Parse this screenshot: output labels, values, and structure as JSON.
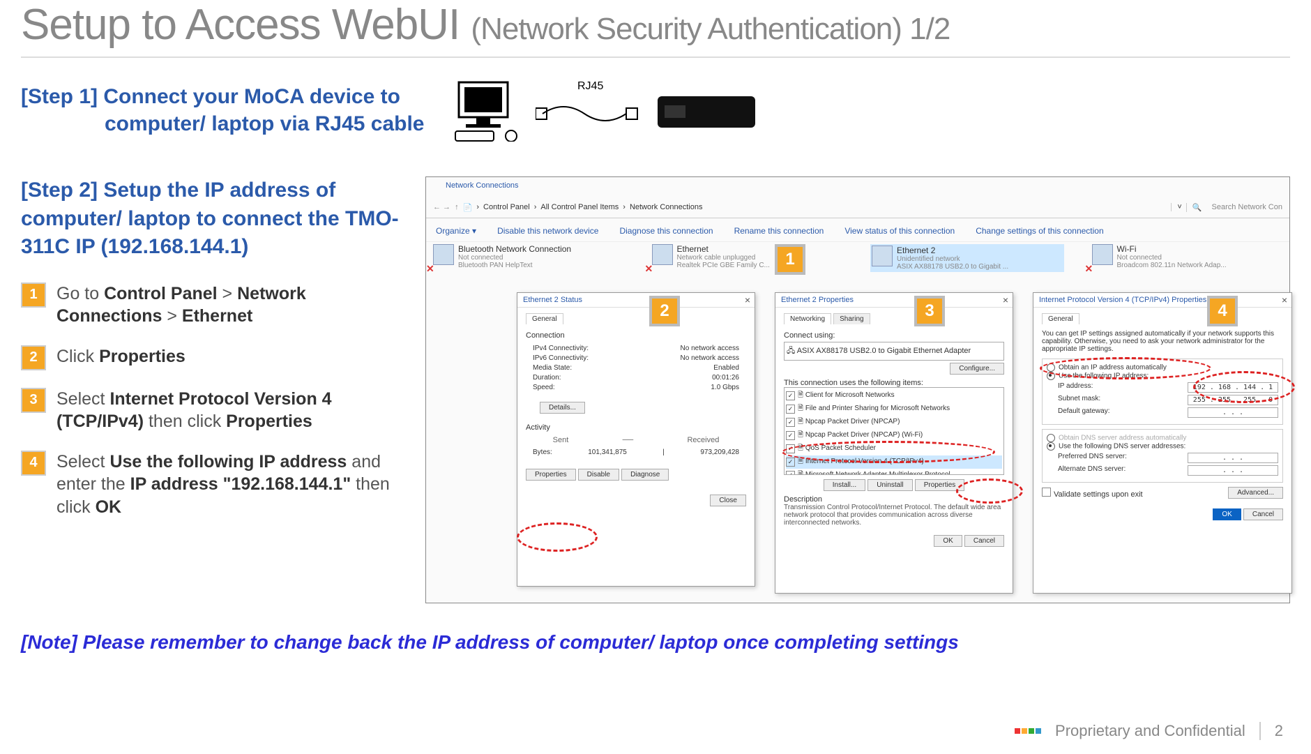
{
  "title_main": "Setup to Access WebUI ",
  "title_sub": "(Network Security Authentication) 1/2",
  "step1_line1": "[Step 1] Connect your MoCA device to",
  "step1_line2": "computer/ laptop via RJ45 cable",
  "rj45_label": "RJ45",
  "step2_head": "[Step 2] Setup the IP address of computer/ laptop to connect the TMO-311C IP (192.168.144.1)",
  "items": [
    {
      "n": "1",
      "html": "Go to <b>Control Panel</b> > <b>Network Connections</b>  > <b>Ethernet</b>"
    },
    {
      "n": "2",
      "html": "Click <b>Properties</b>"
    },
    {
      "n": "3",
      "html": "Select <b>Internet Protocol Version 4 (TCP/IPv4)</b> then click <b>Properties</b>"
    },
    {
      "n": "4",
      "html": "Select <b>Use the following IP address</b> and enter the <b>IP address \"192.168.144.1\"</b> then click <b>OK</b>"
    }
  ],
  "explorer": {
    "win_label": "Network Connections",
    "breadcrumb": [
      "Control Panel",
      "All Control Panel Items",
      "Network Connections"
    ],
    "search_placeholder": "Search Network Con",
    "toolbar": [
      "Organize ▾",
      "Disable this network device",
      "Diagnose this connection",
      "Rename this connection",
      "View status of this connection",
      "Change settings of this connection"
    ],
    "adapters": [
      {
        "name": "Bluetooth Network Connection",
        "status": "Not connected",
        "detail": "Bluetooth PAN HelpText",
        "x": true
      },
      {
        "name": "Ethernet",
        "status": "Network cable unplugged",
        "detail": "Realtek PCIe GBE Family C...",
        "x": true
      },
      {
        "name": "Ethernet 2",
        "status": "Unidentified network",
        "detail": "ASIX AX88178 USB2.0 to Gigabit ...",
        "x": false,
        "sel": true
      },
      {
        "name": "Wi-Fi",
        "status": "Not connected",
        "detail": "Broadcom 802.11n Network Adap...",
        "x": true
      }
    ]
  },
  "win2": {
    "title": "Ethernet 2 Status",
    "tab": "General",
    "section": "Connection",
    "rows": [
      [
        "IPv4 Connectivity:",
        "No network access"
      ],
      [
        "IPv6 Connectivity:",
        "No network access"
      ],
      [
        "Media State:",
        "Enabled"
      ],
      [
        "Duration:",
        "00:01:26"
      ],
      [
        "Speed:",
        "1.0 Gbps"
      ]
    ],
    "details_btn": "Details...",
    "activity": "Activity",
    "sent": "Sent",
    "received": "Received",
    "bytes_label": "Bytes:",
    "bytes_sent": "101,341,875",
    "bytes_recv": "973,209,428",
    "btns": [
      "Properties",
      "Disable",
      "Diagnose"
    ],
    "close": "Close"
  },
  "win3": {
    "title": "Ethernet 2 Properties",
    "tabs": [
      "Networking",
      "Sharing"
    ],
    "connect_using": "Connect using:",
    "adapter": "ASIX AX88178 USB2.0 to Gigabit Ethernet Adapter",
    "configure": "Configure...",
    "uses_label": "This connection uses the following items:",
    "items": [
      "Client for Microsoft Networks",
      "File and Printer Sharing for Microsoft Networks",
      "Npcap Packet Driver (NPCAP)",
      "Npcap Packet Driver (NPCAP) (Wi-Fi)",
      "QoS Packet Scheduler",
      "Internet Protocol Version 4 (TCP/IPv4)",
      "Microsoft Network Adapter Multiplexor Protocol"
    ],
    "btns": [
      "Install...",
      "Uninstall",
      "Properties"
    ],
    "desc_label": "Description",
    "desc": "Transmission Control Protocol/Internet Protocol. The default wide area network protocol that provides communication across diverse interconnected networks.",
    "ok": "OK",
    "cancel": "Cancel"
  },
  "win4": {
    "title": "Internet Protocol Version 4 (TCP/IPv4) Properties",
    "tab": "General",
    "intro": "You can get IP settings assigned automatically if your network supports this capability. Otherwise, you need to ask your network administrator for the appropriate IP settings.",
    "r1": "Obtain an IP address automatically",
    "r2": "Use the following IP address:",
    "ip_label": "IP address:",
    "ip": "192 . 168 . 144 .   1",
    "mask_label": "Subnet mask:",
    "mask": "255 . 255 . 255 .   0",
    "gw_label": "Default gateway:",
    "gw": ".       .       .",
    "r3": "Obtain DNS server address automatically",
    "r4": "Use the following DNS server addresses:",
    "dns1_label": "Preferred DNS server:",
    "dns1": ".       .       .",
    "dns2_label": "Alternate DNS server:",
    "dns2": ".       .       .",
    "validate": "Validate settings upon exit",
    "advanced": "Advanced...",
    "ok": "OK",
    "cancel": "Cancel"
  },
  "callouts": {
    "c1": "1",
    "c2": "2",
    "c3": "3",
    "c4": "4"
  },
  "note": "[Note] Please remember to change back the IP address of computer/ laptop once completing settings",
  "footer_text": "Proprietary and Confidential",
  "page_num": "2"
}
